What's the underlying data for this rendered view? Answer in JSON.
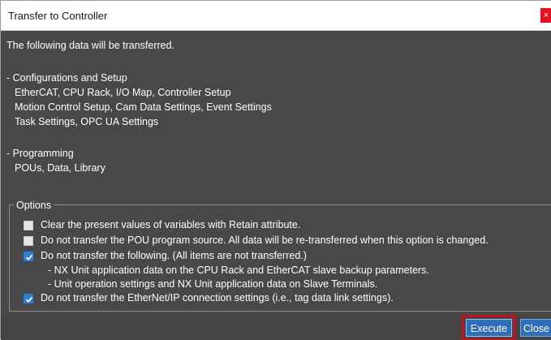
{
  "window": {
    "title": "Transfer to Controller",
    "close_glyph": "×"
  },
  "intro": "The following data will be transferred.",
  "sections": {
    "config_header": "- Configurations and Setup",
    "config_lines": [
      "EtherCAT, CPU Rack, I/O Map, Controller Setup",
      "Motion Control Setup, Cam Data Settings, Event Settings",
      "Task Settings, OPC UA Settings"
    ],
    "programming_header": "- Programming",
    "programming_lines": [
      "POUs, Data, Library"
    ]
  },
  "options": {
    "legend": "Options",
    "items": [
      {
        "label": "Clear the present values of variables with Retain attribute.",
        "checked": false
      },
      {
        "label": "Do not transfer the POU program source. All data will be re-transferred when this option is changed.",
        "checked": false
      },
      {
        "label": "Do not transfer the following. (All items are not transferred.)",
        "checked": true
      },
      {
        "label": "Do not transfer the EtherNet/IP connection settings (i.e., tag data link settings).",
        "checked": true
      }
    ],
    "subitems": [
      "- NX Unit application data on the CPU Rack and EtherCAT slave backup parameters.",
      "- Unit operation settings and NX Unit application data on Slave Terminals."
    ]
  },
  "buttons": {
    "execute": "Execute",
    "close": "Close"
  },
  "colors": {
    "background": "#484848",
    "checkbox_checked": "#2d7dd2",
    "button": "#2f6fb8",
    "highlight_outline": "#c0121f",
    "close_button": "#e81123"
  }
}
